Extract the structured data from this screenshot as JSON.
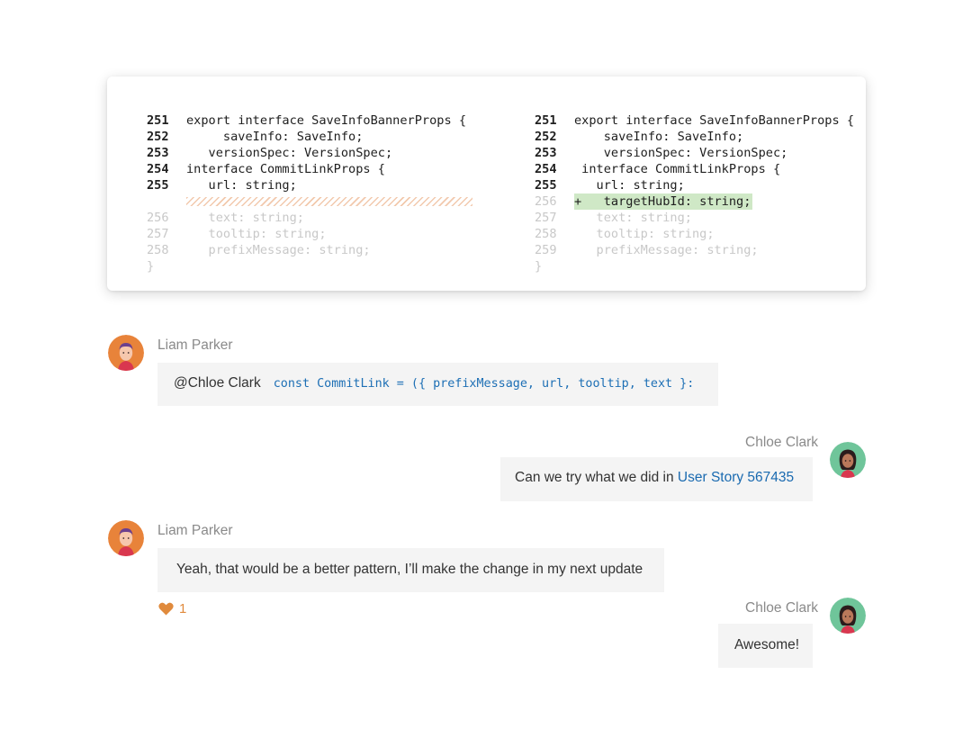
{
  "diff": {
    "left": [
      {
        "ln": "251",
        "text": "export interface SaveInfoBannerProps {",
        "state": "normal"
      },
      {
        "ln": "252",
        "text": "     saveInfo: SaveInfo;",
        "state": "normal"
      },
      {
        "ln": "253",
        "text": "   versionSpec: VersionSpec;",
        "state": "normal"
      },
      {
        "ln": "254",
        "text": "interface CommitLinkProps {",
        "state": "normal"
      },
      {
        "ln": "255",
        "text": "   url: string;",
        "state": "normal"
      },
      {
        "ln": "256",
        "text": "   text: string;",
        "state": "dim"
      },
      {
        "ln": "257",
        "text": "   tooltip: string;",
        "state": "dim"
      },
      {
        "ln": "258",
        "text": "   prefixMessage: string;",
        "state": "dim"
      },
      {
        "ln": "}",
        "text": "",
        "state": "dim"
      }
    ],
    "right": [
      {
        "ln": "251",
        "text": "export interface SaveInfoBannerProps {",
        "state": "normal"
      },
      {
        "ln": "252",
        "text": "    saveInfo: SaveInfo;",
        "state": "normal"
      },
      {
        "ln": "253",
        "text": "    versionSpec: VersionSpec;",
        "state": "normal"
      },
      {
        "ln": "254",
        "text": " interface CommitLinkProps {",
        "state": "normal"
      },
      {
        "ln": "255",
        "text": "   url: string;",
        "state": "normal"
      },
      {
        "ln": "256",
        "text": "+   targetHubId: string;",
        "state": "added"
      },
      {
        "ln": "257",
        "text": "   text: string;",
        "state": "dim"
      },
      {
        "ln": "258",
        "text": "   tooltip: string;",
        "state": "dim"
      },
      {
        "ln": "259",
        "text": "   prefixMessage: string;",
        "state": "dim"
      },
      {
        "ln": "}",
        "text": "",
        "state": "dim"
      }
    ]
  },
  "messages": [
    {
      "author": "Liam Parker",
      "mention": "@Chloe Clark",
      "code": "const CommitLink = ({ prefixMessage, url, tooltip, text }:"
    },
    {
      "author": "Chloe Clark",
      "text": "Can we try what we did in ",
      "link": "User Story 567435"
    },
    {
      "author": "Liam Parker",
      "text": "Yeah, that would be a better pattern, I’ll make the change in my next update",
      "reaction_count": "1"
    },
    {
      "author": "Chloe Clark",
      "text": "Awesome!"
    }
  ],
  "colors": {
    "accent_link": "#1a6ab0",
    "diff_added_bg": "#cfe8c6",
    "reaction": "#e08a3c"
  }
}
